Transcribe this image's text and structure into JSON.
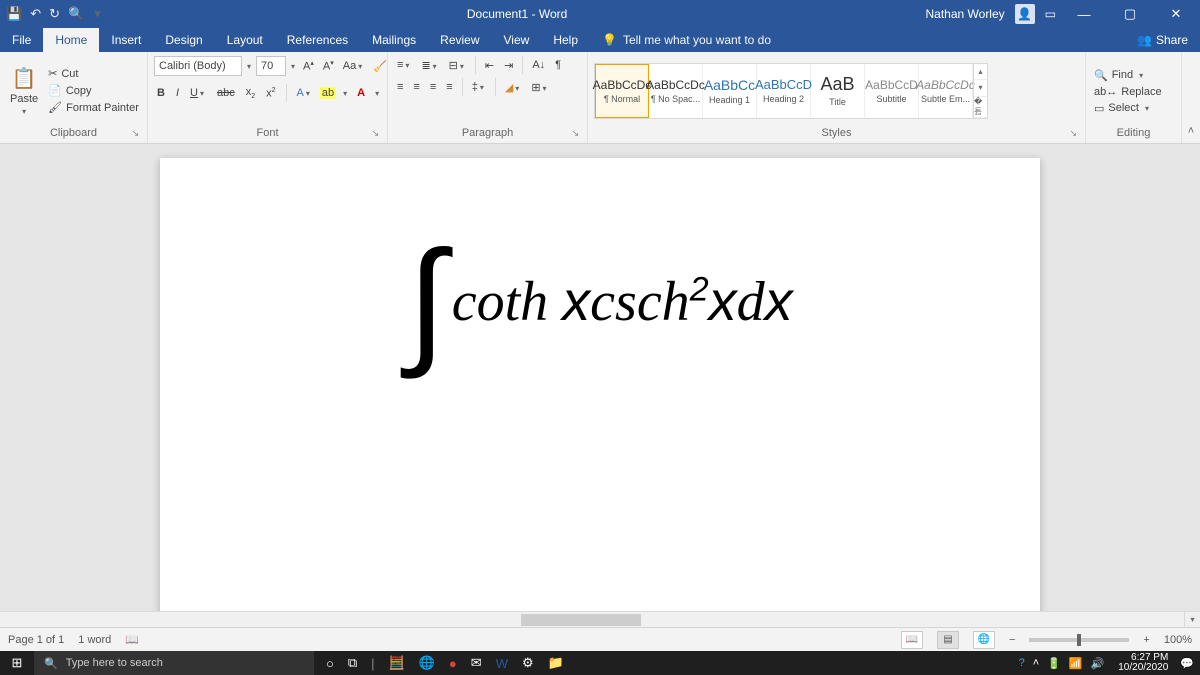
{
  "titlebar": {
    "doc_title": "Document1 - Word",
    "username": "Nathan Worley"
  },
  "tabs": {
    "file": "File",
    "home": "Home",
    "insert": "Insert",
    "design": "Design",
    "layout": "Layout",
    "references": "References",
    "mailings": "Mailings",
    "review": "Review",
    "view": "View",
    "help": "Help",
    "tellme": "Tell me what you want to do",
    "share": "Share"
  },
  "clipboard": {
    "paste": "Paste",
    "cut": "Cut",
    "copy": "Copy",
    "fmt": "Format Painter",
    "group": "Clipboard"
  },
  "font": {
    "name": "Calibri (Body)",
    "size": "70",
    "group": "Font"
  },
  "paragraph": {
    "group": "Paragraph"
  },
  "styles": {
    "group": "Styles",
    "items": [
      {
        "prev": "AaBbCcDc",
        "name": "¶ Normal"
      },
      {
        "prev": "AaBbCcDc",
        "name": "¶ No Spac..."
      },
      {
        "prev": "AaBbCc",
        "name": "Heading 1",
        "cls": "h1"
      },
      {
        "prev": "AaBbCcD",
        "name": "Heading 2",
        "cls": "h2"
      },
      {
        "prev": "AaB",
        "name": "Title",
        "cls": "ti"
      },
      {
        "prev": "AaBbCcD",
        "name": "Subtitle",
        "cls": "sub"
      },
      {
        "prev": "AaBbCcDc",
        "name": "Subtle Em...",
        "cls": "se"
      }
    ]
  },
  "editing": {
    "find": "Find",
    "replace": "Replace",
    "select": "Select",
    "group": "Editing"
  },
  "document": {
    "eq_body": "coth 𝑥csch²𝑥d𝑥"
  },
  "status": {
    "page": "Page 1 of 1",
    "words": "1 word",
    "zoom": "100%"
  },
  "taskbar": {
    "search": "Type here to search",
    "time": "6:27 PM",
    "date": "10/20/2020"
  }
}
